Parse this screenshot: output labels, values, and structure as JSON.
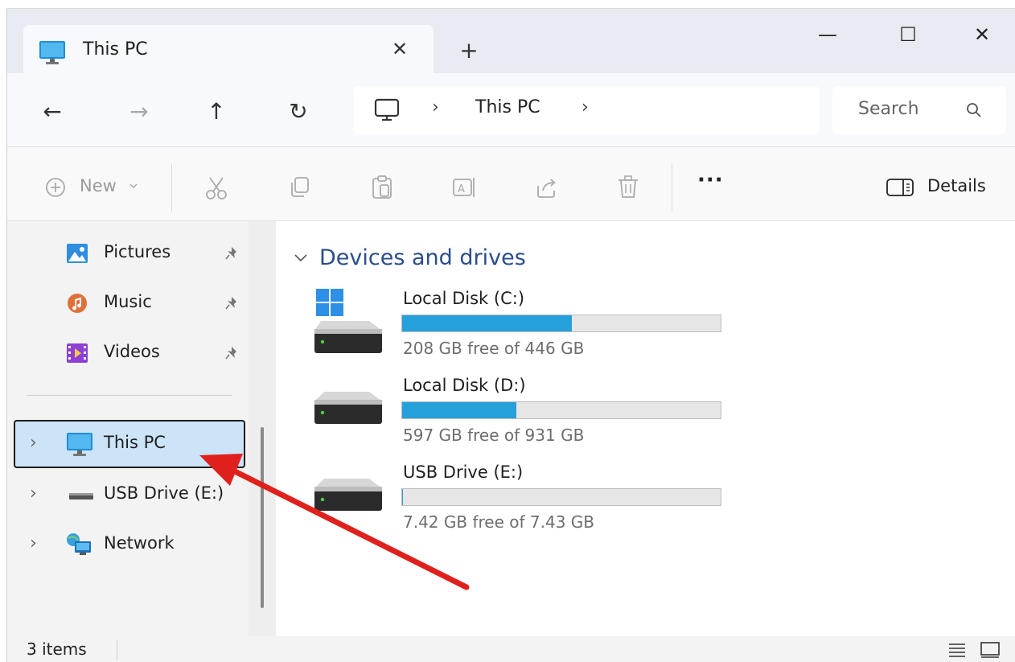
{
  "tab": {
    "title": "This PC",
    "close_glyph": "✕",
    "new_tab_glyph": "+"
  },
  "window_controls": {
    "minimize": "—",
    "maximize": "☐",
    "close": "✕"
  },
  "nav": {
    "back": "←",
    "forward": "→",
    "up": "↑",
    "refresh": "↻"
  },
  "address": {
    "separator": "›",
    "location": "This PC",
    "trailing": "›"
  },
  "search": {
    "placeholder": "Search"
  },
  "command_bar": {
    "new_label": "New",
    "more_label": "···",
    "details_label": "Details",
    "icons": [
      "add-icon",
      "cut-icon",
      "copy-icon",
      "paste-icon",
      "rename-icon",
      "share-icon",
      "delete-icon"
    ]
  },
  "sidebar": {
    "quick_access": [
      {
        "label": "Pictures",
        "icon": "pictures-icon",
        "pinned": true
      },
      {
        "label": "Music",
        "icon": "music-icon",
        "pinned": true
      },
      {
        "label": "Videos",
        "icon": "videos-icon",
        "pinned": true
      }
    ],
    "locations": [
      {
        "label": "This PC",
        "icon": "monitor-icon",
        "selected": true
      },
      {
        "label": "USB Drive (E:)",
        "icon": "usb-drive-icon",
        "selected": false
      },
      {
        "label": "Network",
        "icon": "network-icon",
        "selected": false
      }
    ]
  },
  "main": {
    "group_title": "Devices and drives",
    "drives": [
      {
        "name": "Local Disk (C:)",
        "free_text": "208 GB free of 446 GB",
        "used_fraction": 0.534,
        "icon": "windows-drive-icon"
      },
      {
        "name": "Local Disk (D:)",
        "free_text": "597 GB free of 931 GB",
        "used_fraction": 0.359,
        "icon": "drive-icon"
      },
      {
        "name": "USB Drive (E:)",
        "free_text": "7.42 GB free of 7.43 GB",
        "used_fraction": 0.001,
        "icon": "drive-icon"
      }
    ]
  },
  "status": {
    "items": "3 items"
  },
  "colors": {
    "accent": "#26a0da",
    "selection": "#cce4f7",
    "group_title": "#2b4d8c",
    "annotation_arrow": "#e0201c"
  }
}
